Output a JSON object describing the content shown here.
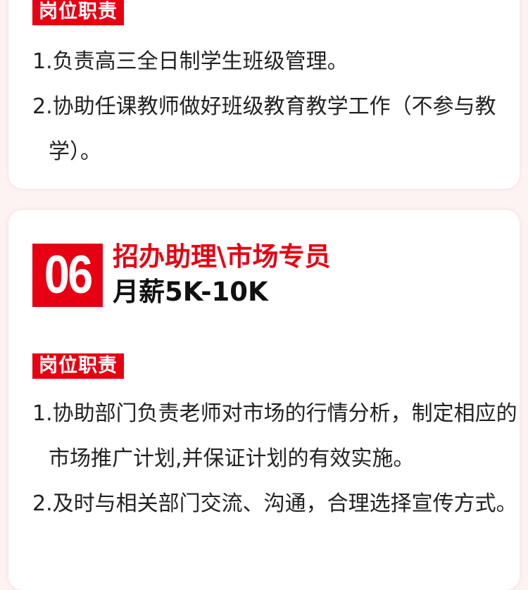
{
  "section1": {
    "tag": "岗位职责",
    "items": [
      "1.负责高三全日制学生班级管理。",
      "2.协助任课教师做好班级教育教学工作（不参与教学）。"
    ]
  },
  "section2": {
    "number": "06",
    "title": "招办助理\\市场专员",
    "salary": "月薪5K-10K",
    "tag": "岗位职责",
    "items": [
      "1.协助部门负责老师对市场的行情分析，制定相应的市场推广计划,并保证计划的有效实施。",
      "2.及时与相关部门交流、沟通，合理选择宣传方式。"
    ]
  },
  "colors": {
    "accent": "#e60012",
    "background": "#fdf3f3",
    "card": "#ffffff"
  }
}
